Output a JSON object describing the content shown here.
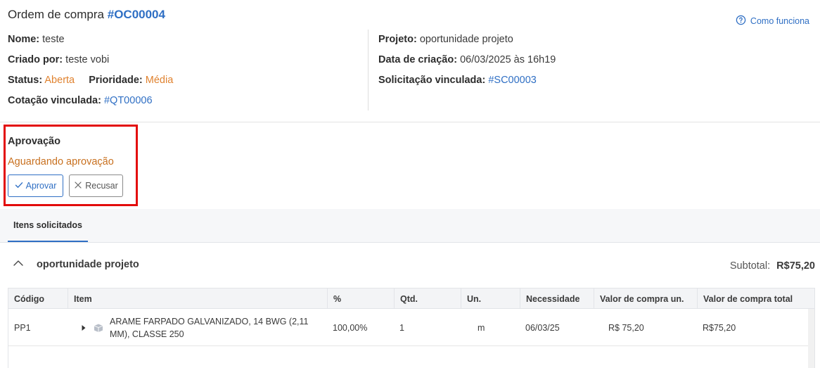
{
  "header": {
    "title_prefix": "Ordem de compra",
    "order_code": "#OC00004",
    "help_label": "Como funciona"
  },
  "left_info": {
    "name_label": "Nome:",
    "name_value": "teste",
    "created_by_label": "Criado por:",
    "created_by_value": "teste vobi",
    "status_label": "Status:",
    "status_value": "Aberta",
    "priority_label": "Prioridade:",
    "priority_value": "Média",
    "quote_label": "Cotação vinculada:",
    "quote_value": "#QT00006"
  },
  "right_info": {
    "project_label": "Projeto:",
    "project_value": "oportunidade projeto",
    "created_date_label": "Data de criação:",
    "created_date_value": "06/03/2025 às 16h19",
    "request_label": "Solicitação vinculada:",
    "request_value": "#SC00003"
  },
  "approval": {
    "title": "Aprovação",
    "status": "Aguardando aprovação",
    "approve_label": "Aprovar",
    "refuse_label": "Recusar"
  },
  "tabs": [
    {
      "label": "Itens solicitados",
      "active": true
    }
  ],
  "group": {
    "name": "oportunidade projeto",
    "subtotal_label": "Subtotal:",
    "subtotal_value": "R$75,20"
  },
  "table": {
    "columns": [
      "Código",
      "Item",
      "%",
      "Qtd.",
      "Un.",
      "Necessidade",
      "Valor de compra un.",
      "Valor de compra total"
    ],
    "rows": [
      {
        "code": "PP1",
        "item": "ARAME FARPADO GALVANIZADO, 14 BWG (2,11 MM), CLASSE 250",
        "percent": "100,00%",
        "qty": "1",
        "unit": "m",
        "need": "06/03/25",
        "unit_value": "R$ 75,20",
        "total_value": "R$75,20"
      }
    ]
  },
  "colors": {
    "accent": "#2f6fc4",
    "orange": "#e0822f",
    "highlight_border": "#e30c0c"
  }
}
